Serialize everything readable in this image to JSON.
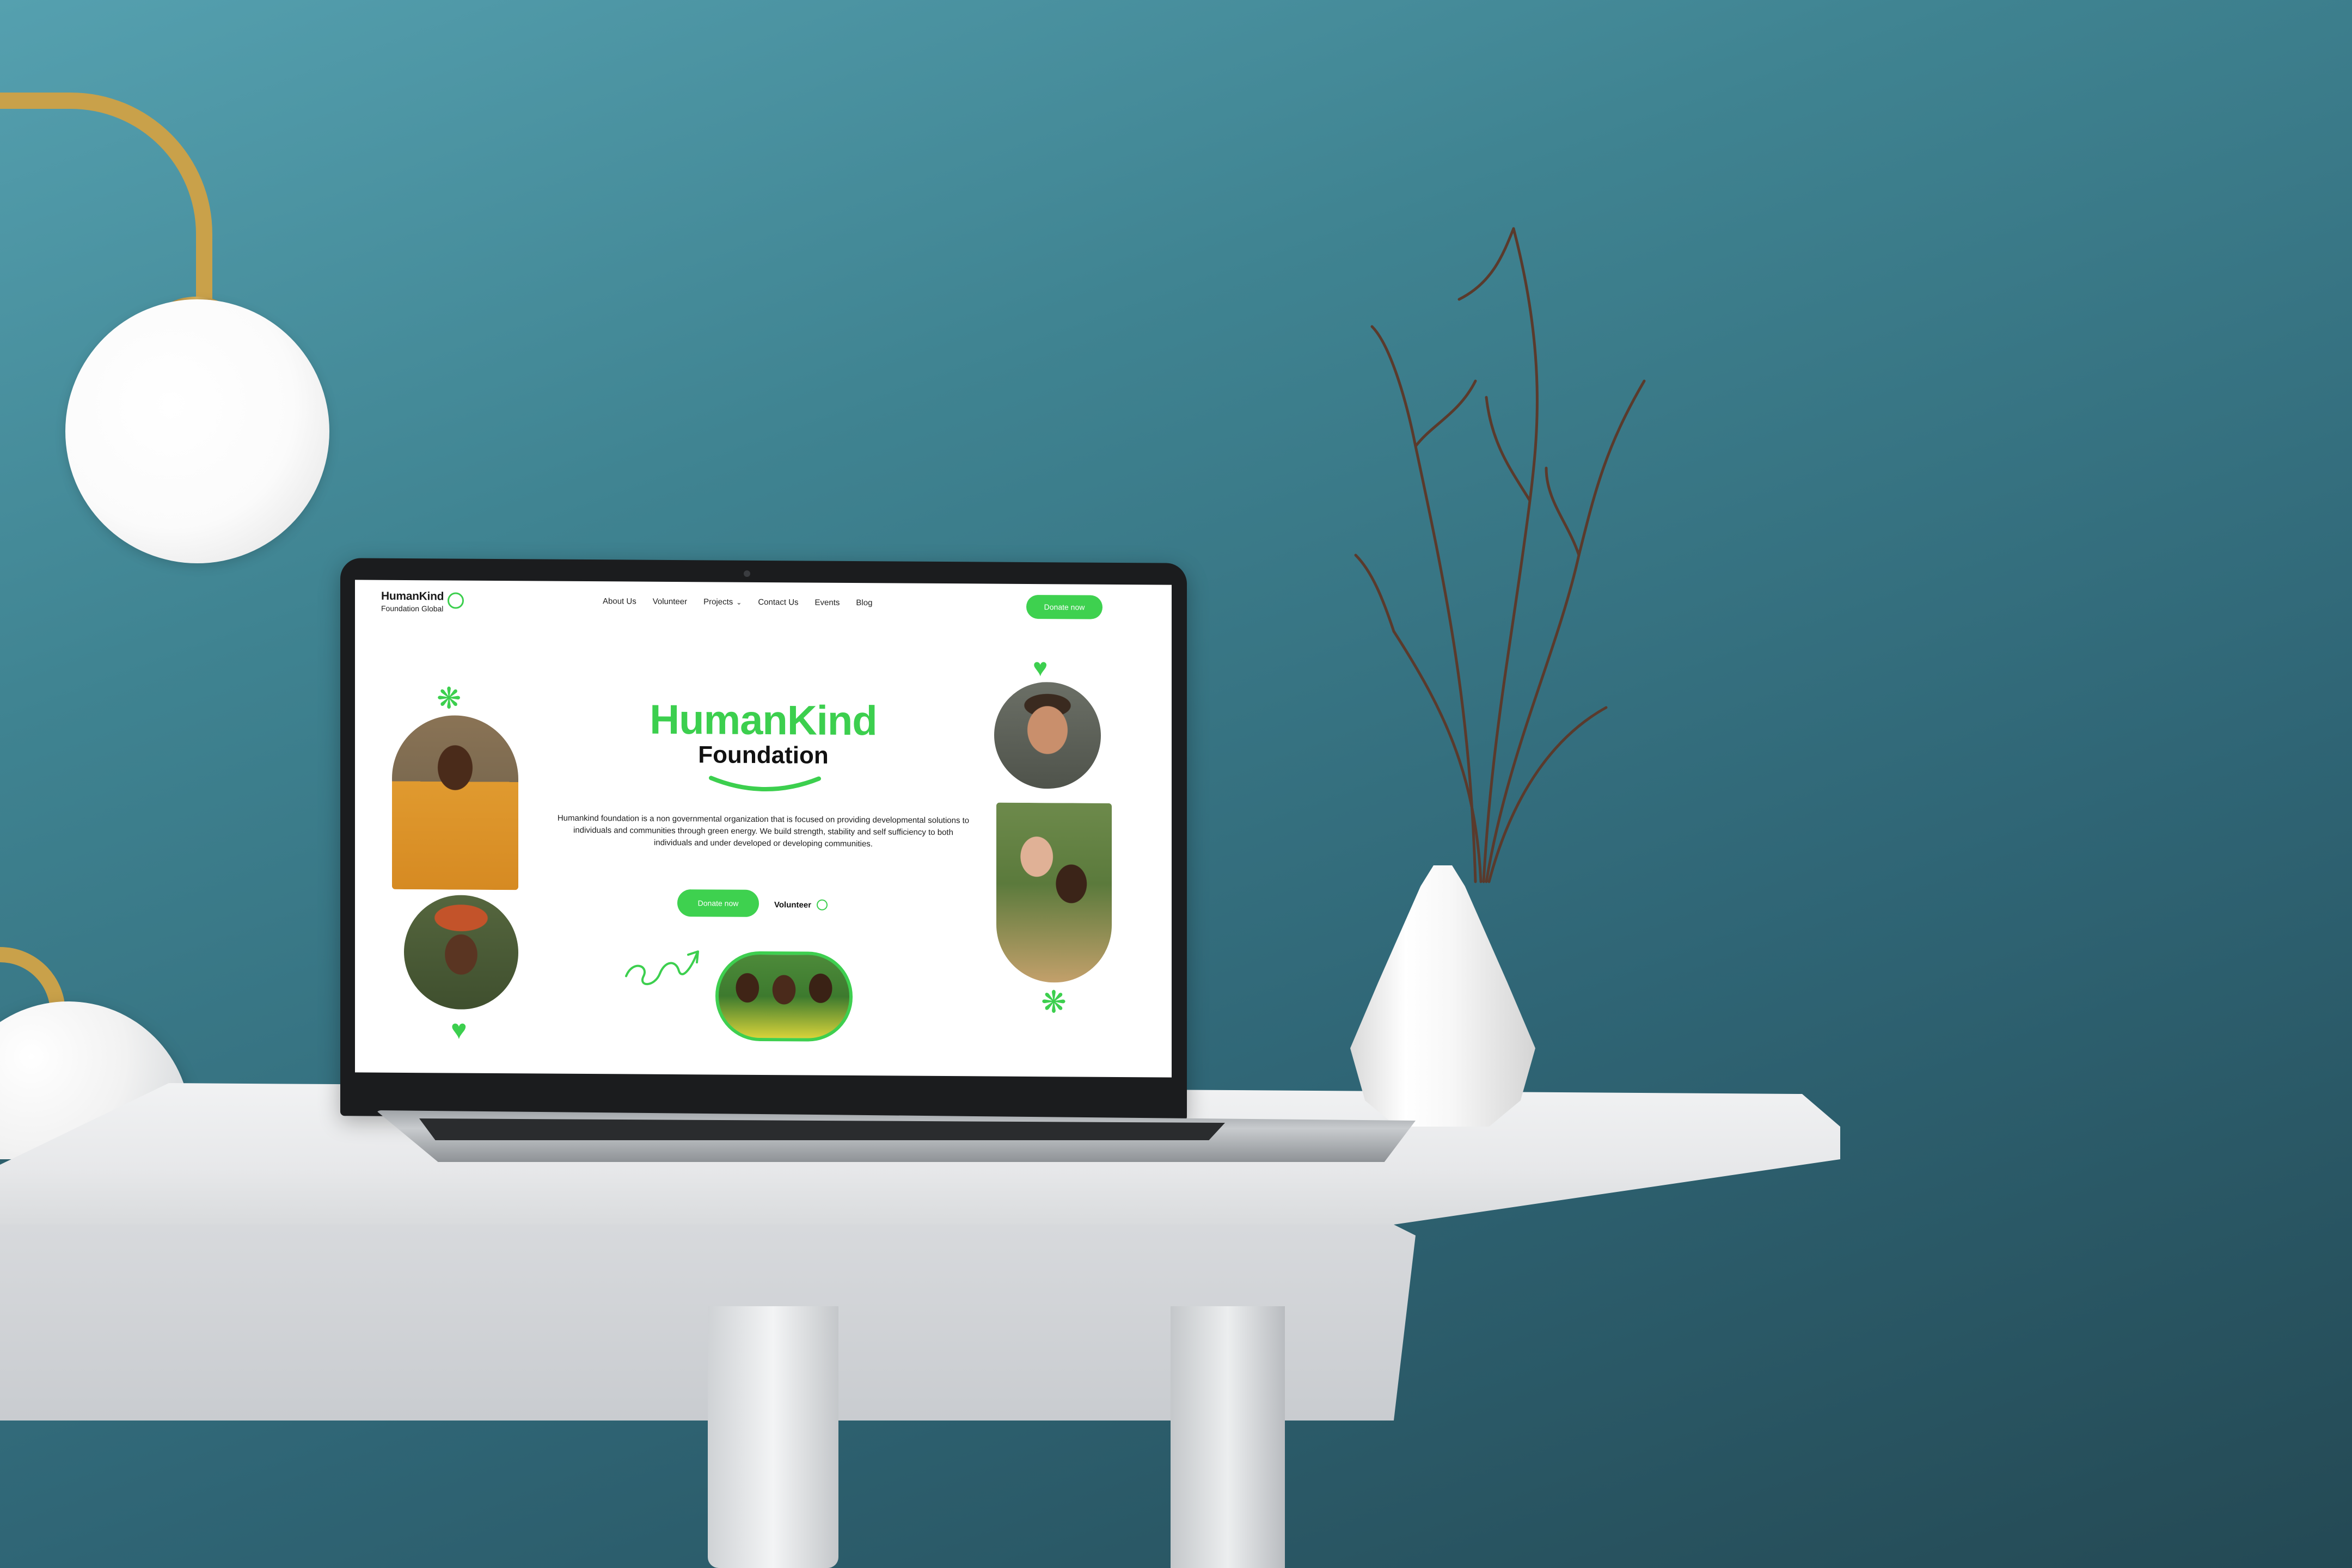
{
  "site": {
    "logo_line1": "HumanKind",
    "logo_line2": "Foundation Global"
  },
  "nav": {
    "links": [
      "About Us",
      "Volunteer",
      "Projects",
      "Contact Us",
      "Events",
      "Blog"
    ],
    "donate_label": "Donate now"
  },
  "hero": {
    "title": "HumanKind",
    "subtitle": "Foundation",
    "description": "Humankind foundation is a non governmental organization that is focused on providing developmental solutions to individuals and communities through green energy. We build strength, stability and self sufficiency to both individuals and under developed or developing communities.",
    "donate_label": "Donate now",
    "volunteer_label": "Volunteer"
  },
  "colors": {
    "brand_green": "#3ccf4e",
    "background_teal": "#3f8391"
  },
  "icons": {
    "logo": "heart-icon",
    "projects_dropdown": "chevron-down-icon",
    "volunteer": "heart-icon",
    "decorations": [
      "flower-icon",
      "heart-icon",
      "arrow-swirl-icon"
    ]
  }
}
